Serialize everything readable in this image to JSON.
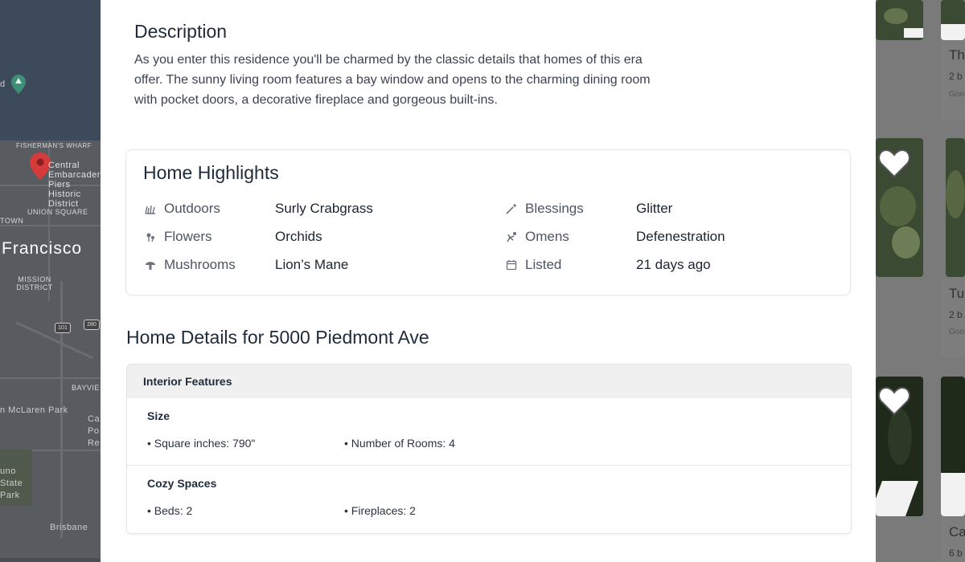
{
  "map": {
    "labels": {
      "fishermans_wharf": "FISHERMAN'S WHARF",
      "district": "Central Embarcadero Piers Historic District",
      "union_square": "UNION SQUARE",
      "town": "TOWN",
      "francisco": "Francisco",
      "mission": "MISSION DISTRICT",
      "bayview": "BAYVIE",
      "mclaren": "n McLaren Park",
      "cal": "Ca Po Re",
      "state_park": "uno State Park",
      "brisbane": "Brisbane",
      "hwy101": "101",
      "hwy280": "280"
    }
  },
  "listings": {
    "cards": [
      {
        "title": "Th",
        "meta": "2 b",
        "agent": "Goo"
      },
      {
        "title": "Tu",
        "meta": "2 b",
        "agent": "Goo"
      },
      {
        "title": "Ca",
        "meta": "6 b",
        "agent": ""
      }
    ]
  },
  "description": {
    "title": "Description",
    "text": "As you enter this residence you'll be charmed by the classic details that homes of this era offer. The sunny living room features a bay window and opens to the charming dining room with pocket doors, a decorative fireplace and gorgeous built-ins."
  },
  "highlights": {
    "title": "Home Highlights",
    "items": [
      {
        "icon": "grass-icon",
        "label": "Outdoors",
        "value": "Surly Crabgrass"
      },
      {
        "icon": "flower-icon",
        "label": "Flowers",
        "value": "Orchids"
      },
      {
        "icon": "mushroom-icon",
        "label": "Mushrooms",
        "value": "Lion’s Mane"
      },
      {
        "icon": "sparkle-wand-icon",
        "label": "Blessings",
        "value": "Glitter"
      },
      {
        "icon": "falling-person-icon",
        "label": "Omens",
        "value": "Defenestration"
      },
      {
        "icon": "calendar-icon",
        "label": "Listed",
        "value": "21 days ago"
      }
    ]
  },
  "details": {
    "title": "Home Details for 5000 Piedmont Ave",
    "header": "Interior Features",
    "sections": [
      {
        "title": "Size",
        "items": [
          "• Square inches: 790\"",
          "• Number of Rooms: 4"
        ]
      },
      {
        "title": "Cozy Spaces",
        "items": [
          "• Beds: 2",
          "• Fireplaces: 2"
        ]
      }
    ]
  },
  "colors": {
    "heading": "#1e2b3a",
    "overlay": "#666666"
  }
}
